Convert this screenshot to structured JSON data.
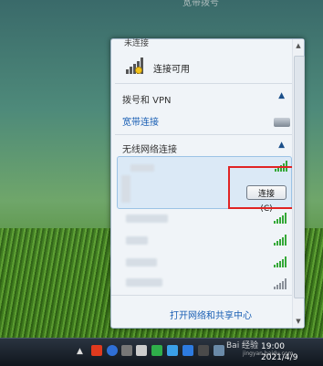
{
  "desktop": {
    "title": "宽带拨号"
  },
  "panel": {
    "top_partial": "未连接",
    "status": "连接可用",
    "dialup_section": "拨号和 VPN",
    "broadband": "宽带连接",
    "wireless_section": "无线网络连接",
    "connect_button": "连接(C)",
    "footer_link": "打开网络和共享中心"
  },
  "taskbar": {
    "chevron": "▲",
    "time": "19:00",
    "date": "2021/4/9",
    "watermark": "Bai 经验",
    "watermark_sub": "jingyan.baidu.com"
  },
  "colors": {
    "accent": "#1a5fb4",
    "highlight": "#e02424",
    "signal": "#35a838"
  }
}
